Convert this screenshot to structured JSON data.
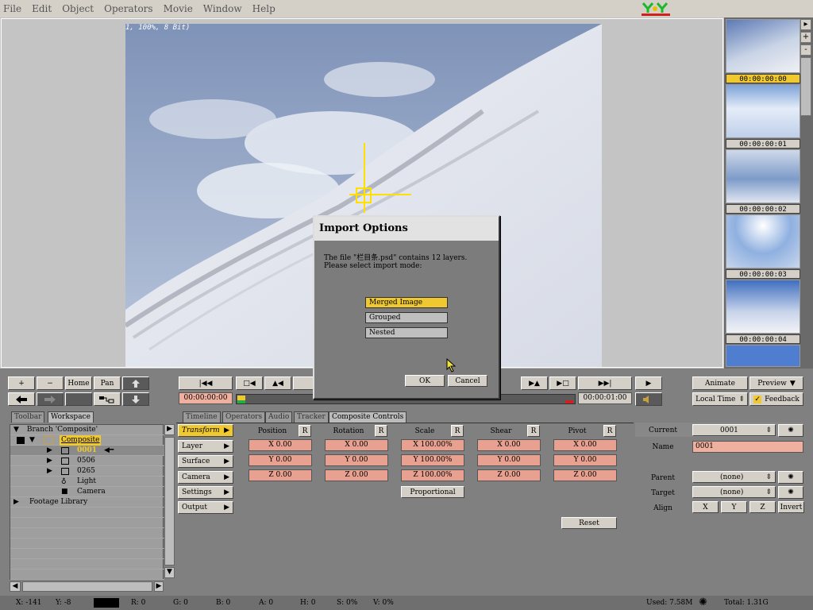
{
  "menu": [
    "File",
    "Edit",
    "Object",
    "Operators",
    "Movie",
    "Window",
    "Help"
  ],
  "viewer": {
    "info": "1, 100%, 8 Bit)"
  },
  "thumbnails": [
    {
      "timecode": "00:00:00:00",
      "selected": true
    },
    {
      "timecode": "00:00:00:01",
      "selected": false
    },
    {
      "timecode": "00:00:00:02",
      "selected": false
    },
    {
      "timecode": "00:00:00:03",
      "selected": false
    },
    {
      "timecode": "00:00:00:04",
      "selected": false
    }
  ],
  "toolbar": {
    "plus": "+",
    "minus": "−",
    "home": "Home",
    "pan": "Pan",
    "start_time": "00:00:00:00",
    "end_time": "00:00:01:00",
    "animate": "Animate",
    "preview": "Preview",
    "local_time": "Local Time",
    "feedback": "Feedback"
  },
  "left_tabs": [
    "Toolbar",
    "Workspace"
  ],
  "tree": {
    "branch": "Branch 'Composite'",
    "composite": "Composite",
    "items": [
      "0001",
      "0506",
      "0265",
      "Light",
      "Camera"
    ],
    "footage": "Footage Library"
  },
  "control_tabs": [
    "Timeline",
    "Operators",
    "Audio",
    "Tracker",
    "Composite Controls"
  ],
  "categories": [
    "Transform",
    "Layer",
    "Surface",
    "Camera",
    "Settings",
    "Output"
  ],
  "groups": [
    {
      "label": "Position",
      "fields": [
        "X 0.00",
        "Y 0.00",
        "Z 0.00"
      ]
    },
    {
      "label": "Rotation",
      "fields": [
        "X 0.00",
        "Y 0.00",
        "Z 0.00"
      ]
    },
    {
      "label": "Scale",
      "fields": [
        "X 100.00%",
        "Y 100.00%",
        "Z 100.00%"
      ]
    },
    {
      "label": "Shear",
      "fields": [
        "X 0.00",
        "Y 0.00",
        "Z 0.00"
      ]
    },
    {
      "label": "Pivot",
      "fields": [
        "X 0.00",
        "Y 0.00",
        "Z 0.00"
      ]
    }
  ],
  "reset_label": "R",
  "proportional": "Proportional",
  "reset": "Reset",
  "right": {
    "current_label": "Current",
    "current_value": "0001",
    "name_label": "Name",
    "name_value": "0001",
    "parent_label": "Parent",
    "parent_value": "(none)",
    "target_label": "Target",
    "target_value": "(none)",
    "align_label": "Align",
    "align_buttons": [
      "X",
      "Y",
      "Z",
      "Invert"
    ]
  },
  "status": {
    "x": "X:  -141",
    "y": "Y:  -8",
    "r": "R: 0",
    "g": "G: 0",
    "b": "B: 0",
    "a": "A: 0",
    "h": "H: 0",
    "s": "S: 0%",
    "v": "V: 0%",
    "used": "Used: 7.58M",
    "total": "Total: 1.31G"
  },
  "dialog": {
    "title": "Import Options",
    "message1": "The file \"栏目条.psd\" contains 12 layers.",
    "message2": "Please select import mode:",
    "options": [
      "Merged Image",
      "Grouped",
      "Nested"
    ],
    "selected": 0,
    "ok": "OK",
    "cancel": "Cancel"
  },
  "colors": {
    "accent": "#f0c830",
    "field": "#e8a090"
  }
}
